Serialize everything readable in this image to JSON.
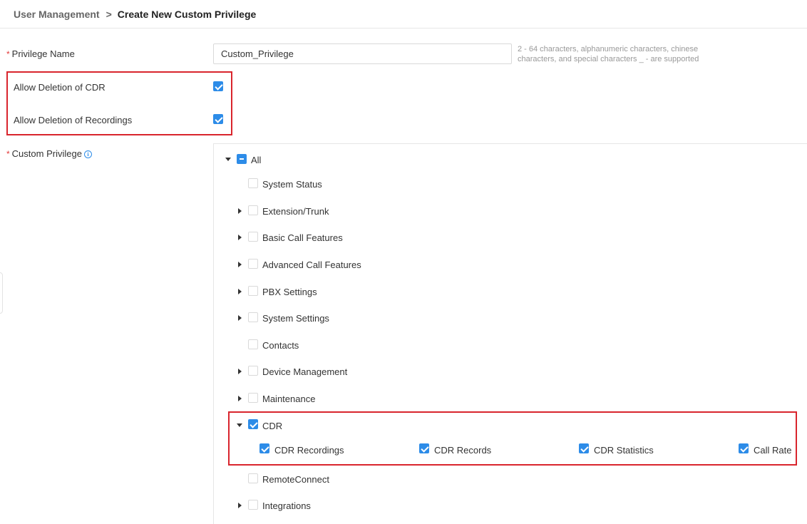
{
  "breadcrumb": {
    "parent": "User Management",
    "separator": ">",
    "current": "Create New Custom Privilege"
  },
  "form": {
    "required_mark": "*",
    "privilege_name": {
      "label": "Privilege Name",
      "value": "Custom_Privilege",
      "hint": "2 - 64 characters, alphanumeric characters, chinese characters, and special characters _ - are supported"
    },
    "options": [
      {
        "label": "Allow Deletion of CDR",
        "checked": true
      },
      {
        "label": "Allow Deletion of Recordings",
        "checked": true
      }
    ],
    "custom_privilege": {
      "label": "Custom Privilege",
      "info_icon": "i"
    }
  },
  "tree": {
    "root": {
      "label": "All",
      "state": "indeterminate",
      "expanded": true
    },
    "items": [
      {
        "label": "System Status",
        "expandable": false,
        "checked": false
      },
      {
        "label": "Extension/Trunk",
        "expandable": true,
        "checked": false
      },
      {
        "label": "Basic Call Features",
        "expandable": true,
        "checked": false
      },
      {
        "label": "Advanced Call Features",
        "expandable": true,
        "checked": false
      },
      {
        "label": "PBX Settings",
        "expandable": true,
        "checked": false
      },
      {
        "label": "System Settings",
        "expandable": true,
        "checked": false
      },
      {
        "label": "Contacts",
        "expandable": false,
        "checked": false
      },
      {
        "label": "Device Management",
        "expandable": true,
        "checked": false
      },
      {
        "label": "Maintenance",
        "expandable": true,
        "checked": false
      },
      {
        "label": "CDR",
        "expandable": true,
        "expanded": true,
        "checked": true
      },
      {
        "label": "RemoteConnect",
        "expandable": false,
        "checked": false
      },
      {
        "label": "Integrations",
        "expandable": true,
        "checked": false
      }
    ],
    "cdr_children": [
      {
        "label": "CDR Recordings",
        "checked": true
      },
      {
        "label": "CDR Records",
        "checked": true
      },
      {
        "label": "CDR Statistics",
        "checked": true
      },
      {
        "label": "Call Rate",
        "checked": true
      }
    ]
  },
  "colors": {
    "accent": "#2d8ce8",
    "highlight": "#d9252d",
    "required": "#e33b3b"
  }
}
